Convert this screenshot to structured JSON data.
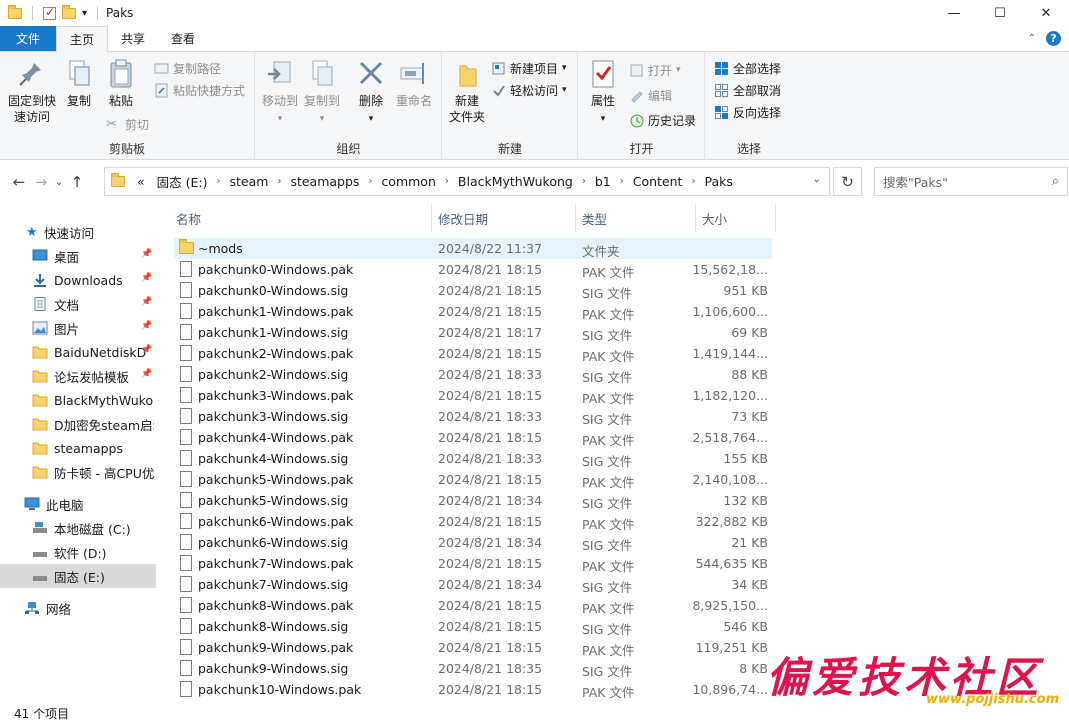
{
  "window": {
    "title": "Paks"
  },
  "ribbon_tabs": [
    "文件",
    "主页",
    "共享",
    "查看"
  ],
  "ribbon": {
    "clipboard": {
      "label": "剪贴板",
      "pin": "固定到快\n速访问",
      "copy": "复制",
      "paste": "粘贴",
      "copy_path": "复制路径",
      "paste_shortcut": "粘贴快捷方式",
      "cut": "剪切"
    },
    "organize": {
      "label": "组织",
      "move_to": "移动到",
      "copy_to": "复制到",
      "delete": "删除",
      "rename": "重命名"
    },
    "new": {
      "label": "新建",
      "new_folder": "新建\n文件夹",
      "new_item": "新建项目",
      "easy_access": "轻松访问"
    },
    "open": {
      "label": "打开",
      "properties": "属性",
      "open": "打开",
      "edit": "编辑",
      "history": "历史记录"
    },
    "select": {
      "label": "选择",
      "select_all": "全部选择",
      "select_none": "全部取消",
      "invert": "反向选择"
    }
  },
  "address": {
    "overflow": "«",
    "crumbs": [
      "固态 (E:)",
      "steam",
      "steamapps",
      "common",
      "BlackMythWukong",
      "b1",
      "Content",
      "Paks"
    ]
  },
  "search": {
    "placeholder": "搜索\"Paks\""
  },
  "nav": {
    "quick_access": "快速访问",
    "quick_items": [
      "桌面",
      "Downloads",
      "文档",
      "图片",
      "BaiduNetdiskD",
      "论坛发帖模板",
      "BlackMythWukong",
      "D加密免steam启动",
      "steamapps",
      "防卡顿 - 高CPU优先"
    ],
    "this_pc": "此电脑",
    "drives": [
      "本地磁盘 (C:)",
      "软件 (D:)",
      "固态 (E:)"
    ],
    "network": "网络"
  },
  "columns": {
    "name": "名称",
    "date": "修改日期",
    "type": "类型",
    "size": "大小"
  },
  "files": [
    {
      "name": "~mods",
      "date": "2024/8/22 11:37",
      "type": "文件夹",
      "size": "",
      "kind": "folder"
    },
    {
      "name": "pakchunk0-Windows.pak",
      "date": "2024/8/21 18:15",
      "type": "PAK 文件",
      "size": "15,562,18...",
      "kind": "file"
    },
    {
      "name": "pakchunk0-Windows.sig",
      "date": "2024/8/21 18:15",
      "type": "SIG 文件",
      "size": "951 KB",
      "kind": "file"
    },
    {
      "name": "pakchunk1-Windows.pak",
      "date": "2024/8/21 18:15",
      "type": "PAK 文件",
      "size": "1,106,600...",
      "kind": "file"
    },
    {
      "name": "pakchunk1-Windows.sig",
      "date": "2024/8/21 18:17",
      "type": "SIG 文件",
      "size": "69 KB",
      "kind": "file"
    },
    {
      "name": "pakchunk2-Windows.pak",
      "date": "2024/8/21 18:15",
      "type": "PAK 文件",
      "size": "1,419,144...",
      "kind": "file"
    },
    {
      "name": "pakchunk2-Windows.sig",
      "date": "2024/8/21 18:33",
      "type": "SIG 文件",
      "size": "88 KB",
      "kind": "file"
    },
    {
      "name": "pakchunk3-Windows.pak",
      "date": "2024/8/21 18:15",
      "type": "PAK 文件",
      "size": "1,182,120...",
      "kind": "file"
    },
    {
      "name": "pakchunk3-Windows.sig",
      "date": "2024/8/21 18:33",
      "type": "SIG 文件",
      "size": "73 KB",
      "kind": "file"
    },
    {
      "name": "pakchunk4-Windows.pak",
      "date": "2024/8/21 18:15",
      "type": "PAK 文件",
      "size": "2,518,764...",
      "kind": "file"
    },
    {
      "name": "pakchunk4-Windows.sig",
      "date": "2024/8/21 18:33",
      "type": "SIG 文件",
      "size": "155 KB",
      "kind": "file"
    },
    {
      "name": "pakchunk5-Windows.pak",
      "date": "2024/8/21 18:15",
      "type": "PAK 文件",
      "size": "2,140,108...",
      "kind": "file"
    },
    {
      "name": "pakchunk5-Windows.sig",
      "date": "2024/8/21 18:34",
      "type": "SIG 文件",
      "size": "132 KB",
      "kind": "file"
    },
    {
      "name": "pakchunk6-Windows.pak",
      "date": "2024/8/21 18:15",
      "type": "PAK 文件",
      "size": "322,882 KB",
      "kind": "file"
    },
    {
      "name": "pakchunk6-Windows.sig",
      "date": "2024/8/21 18:34",
      "type": "SIG 文件",
      "size": "21 KB",
      "kind": "file"
    },
    {
      "name": "pakchunk7-Windows.pak",
      "date": "2024/8/21 18:15",
      "type": "PAK 文件",
      "size": "544,635 KB",
      "kind": "file"
    },
    {
      "name": "pakchunk7-Windows.sig",
      "date": "2024/8/21 18:34",
      "type": "SIG 文件",
      "size": "34 KB",
      "kind": "file"
    },
    {
      "name": "pakchunk8-Windows.pak",
      "date": "2024/8/21 18:15",
      "type": "PAK 文件",
      "size": "8,925,150...",
      "kind": "file"
    },
    {
      "name": "pakchunk8-Windows.sig",
      "date": "2024/8/21 18:15",
      "type": "SIG 文件",
      "size": "546 KB",
      "kind": "file"
    },
    {
      "name": "pakchunk9-Windows.pak",
      "date": "2024/8/21 18:15",
      "type": "PAK 文件",
      "size": "119,251 KB",
      "kind": "file"
    },
    {
      "name": "pakchunk9-Windows.sig",
      "date": "2024/8/21 18:35",
      "type": "SIG 文件",
      "size": "8 KB",
      "kind": "file"
    },
    {
      "name": "pakchunk10-Windows.pak",
      "date": "2024/8/21 18:15",
      "type": "PAK 文件",
      "size": "10,896,74...",
      "kind": "file"
    }
  ],
  "status": {
    "item_count": "41 个项目"
  },
  "watermark": {
    "text": "偏爱技术社区",
    "url": "www.pojjishu.com"
  },
  "colors": {
    "accent": "#1979ca",
    "folder": "#f7d36b",
    "hover_row": "#e5f3ff",
    "selected_nav": "#d9d9d9"
  }
}
